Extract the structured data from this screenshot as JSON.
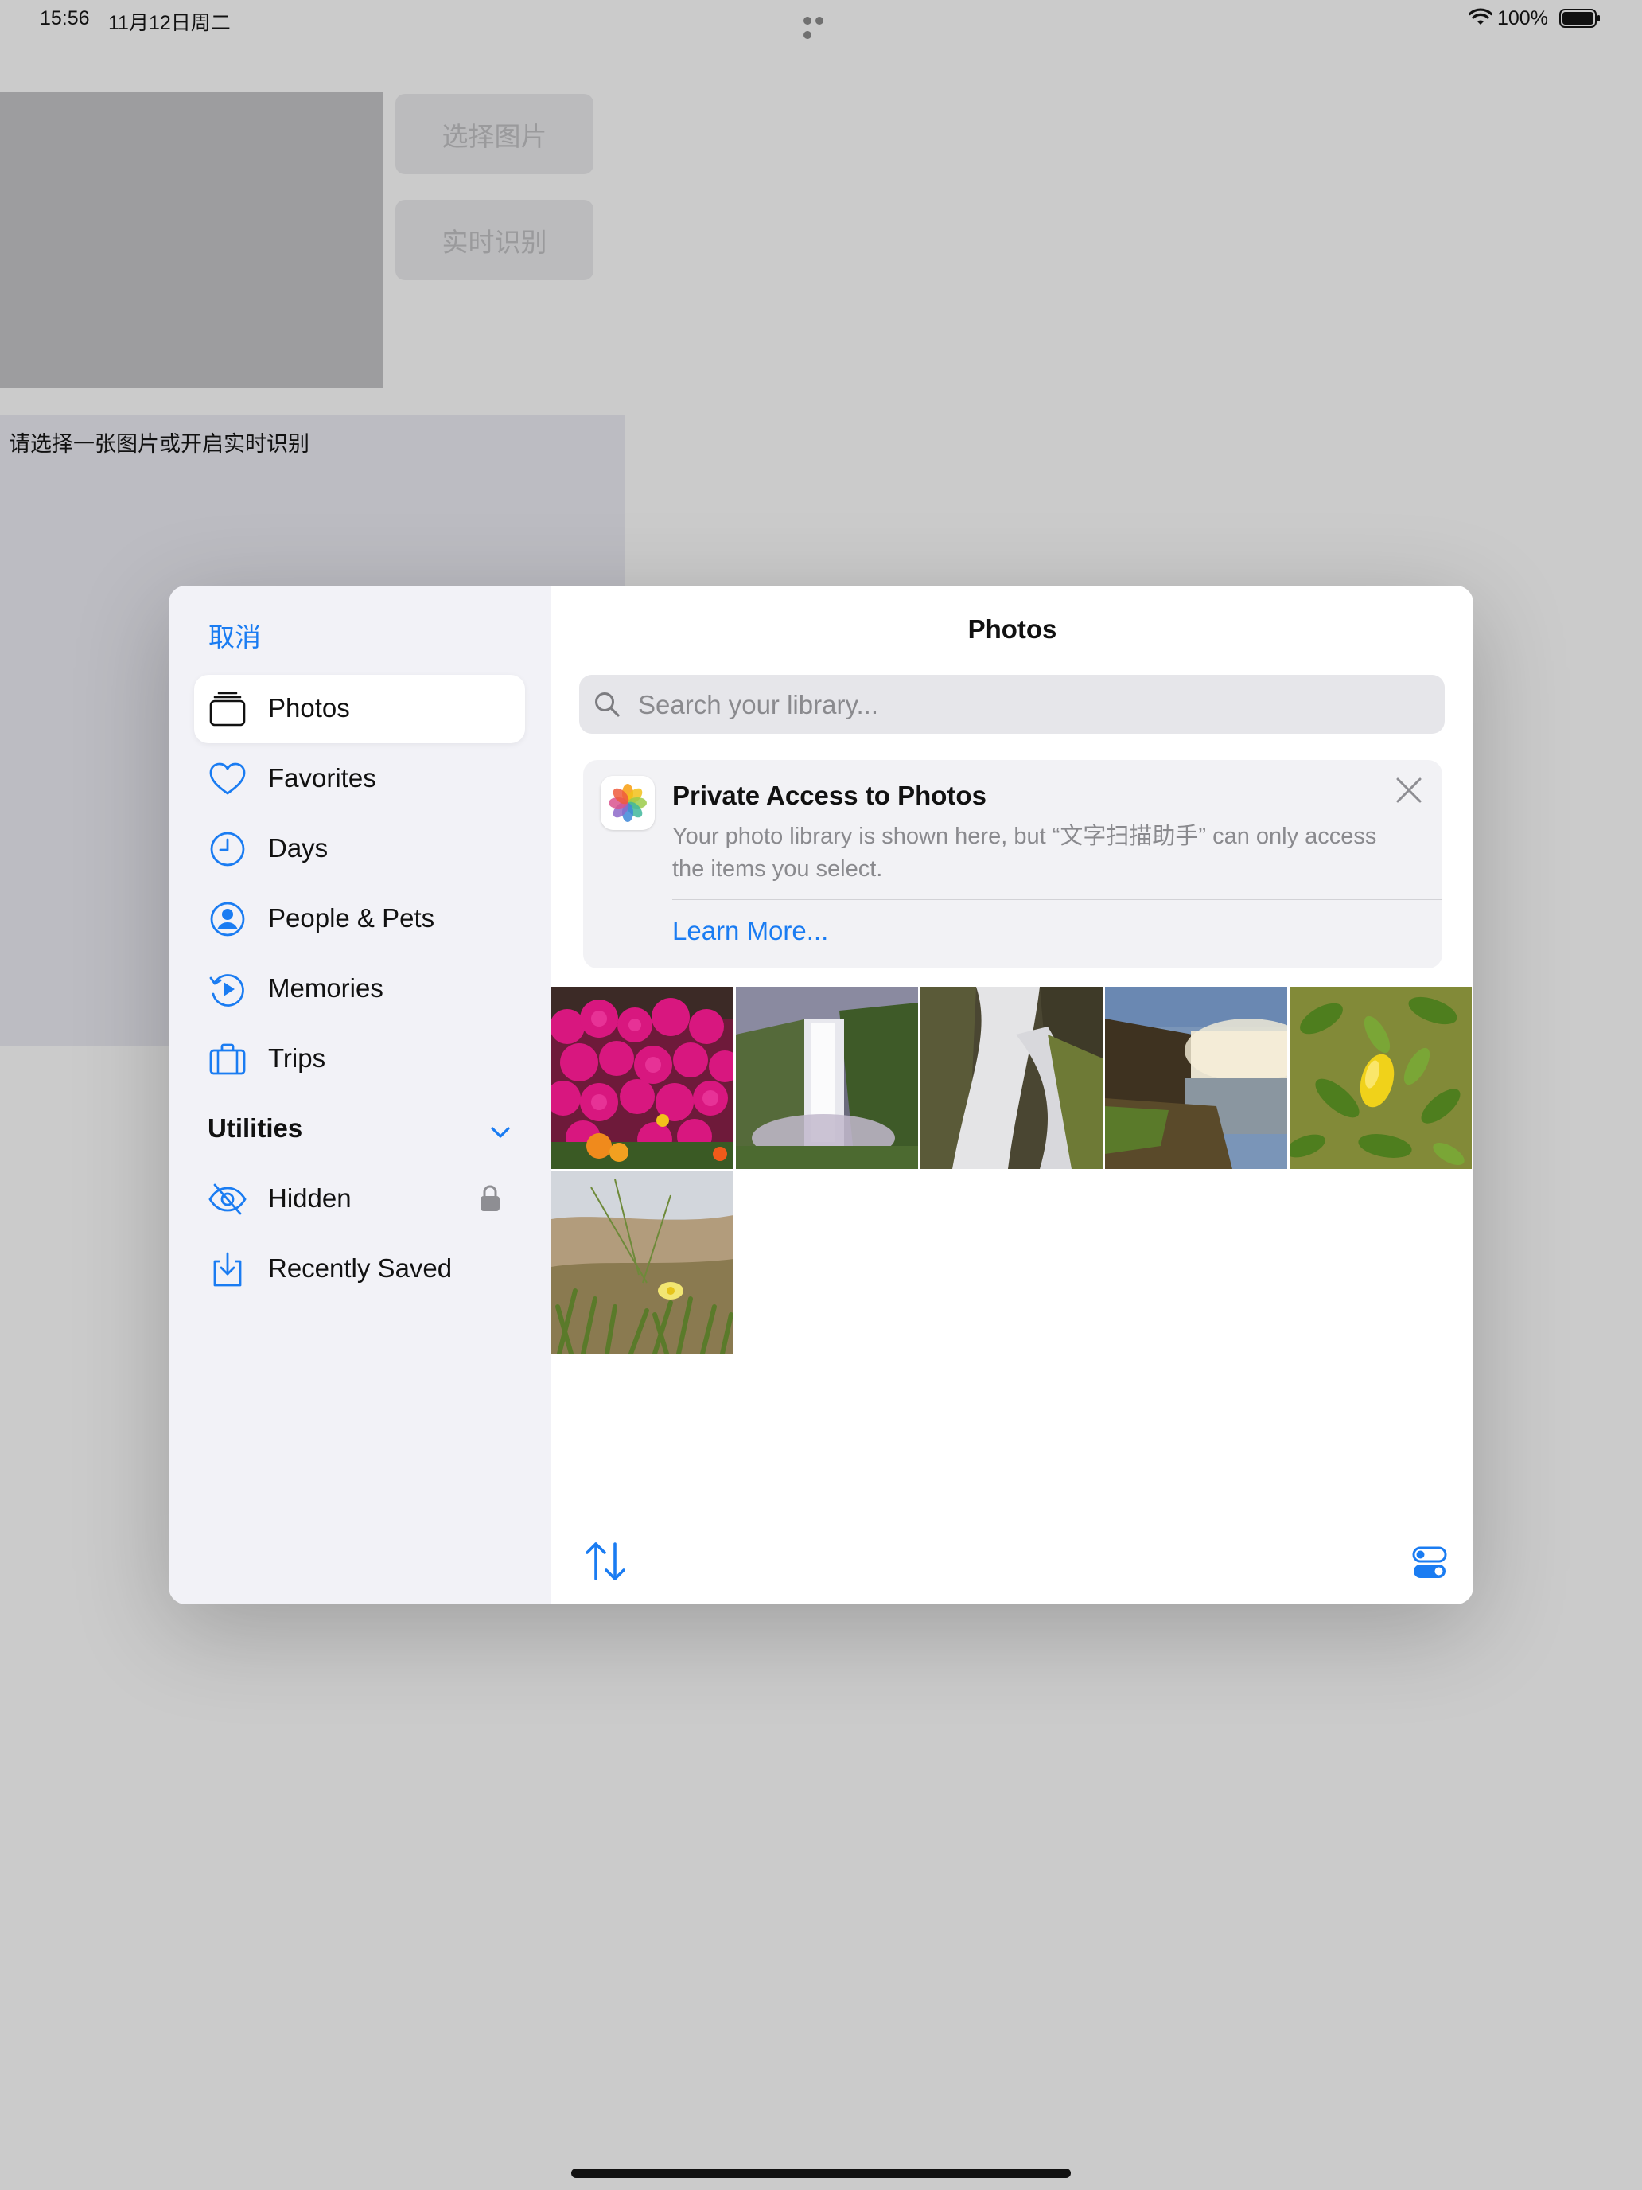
{
  "status_bar": {
    "time": "15:56",
    "date": "11月12日周二",
    "battery": "100%"
  },
  "background_app": {
    "select_image_button": "选择图片",
    "realtime_button": "实时识别",
    "hint_text": "请选择一张图片或开启实时识别"
  },
  "picker": {
    "cancel_label": "取消",
    "title": "Photos",
    "search": {
      "placeholder": "Search your library...",
      "value": ""
    },
    "sidebar": {
      "items": [
        {
          "label": "Photos",
          "icon": "photos-stack-icon",
          "selected": true
        },
        {
          "label": "Favorites",
          "icon": "heart-icon"
        },
        {
          "label": "Days",
          "icon": "clock-icon"
        },
        {
          "label": "People & Pets",
          "icon": "person-circle-icon"
        },
        {
          "label": "Memories",
          "icon": "memories-play-icon"
        },
        {
          "label": "Trips",
          "icon": "suitcase-icon"
        }
      ],
      "utilities_title": "Utilities",
      "utilities": [
        {
          "label": "Hidden",
          "icon": "eye-slash-icon",
          "locked": true
        },
        {
          "label": "Recently Saved",
          "icon": "tray-download-icon"
        }
      ]
    },
    "banner": {
      "title": "Private Access to Photos",
      "body": "Your photo library is shown here, but “文字扫描助手” can only access the items you select.",
      "link": "Learn More..."
    },
    "photos": [
      {
        "subject": "pink-flowers"
      },
      {
        "subject": "waterfall-valley"
      },
      {
        "subject": "waterfall-rocks"
      },
      {
        "subject": "waterfall-cliff"
      },
      {
        "subject": "lemon-tree"
      },
      {
        "subject": "dune-flower"
      }
    ]
  },
  "colors": {
    "accent": "#1a7cf2",
    "sidebar_bg": "#f2f2f7",
    "dim_bg": "#cbcbcb"
  }
}
